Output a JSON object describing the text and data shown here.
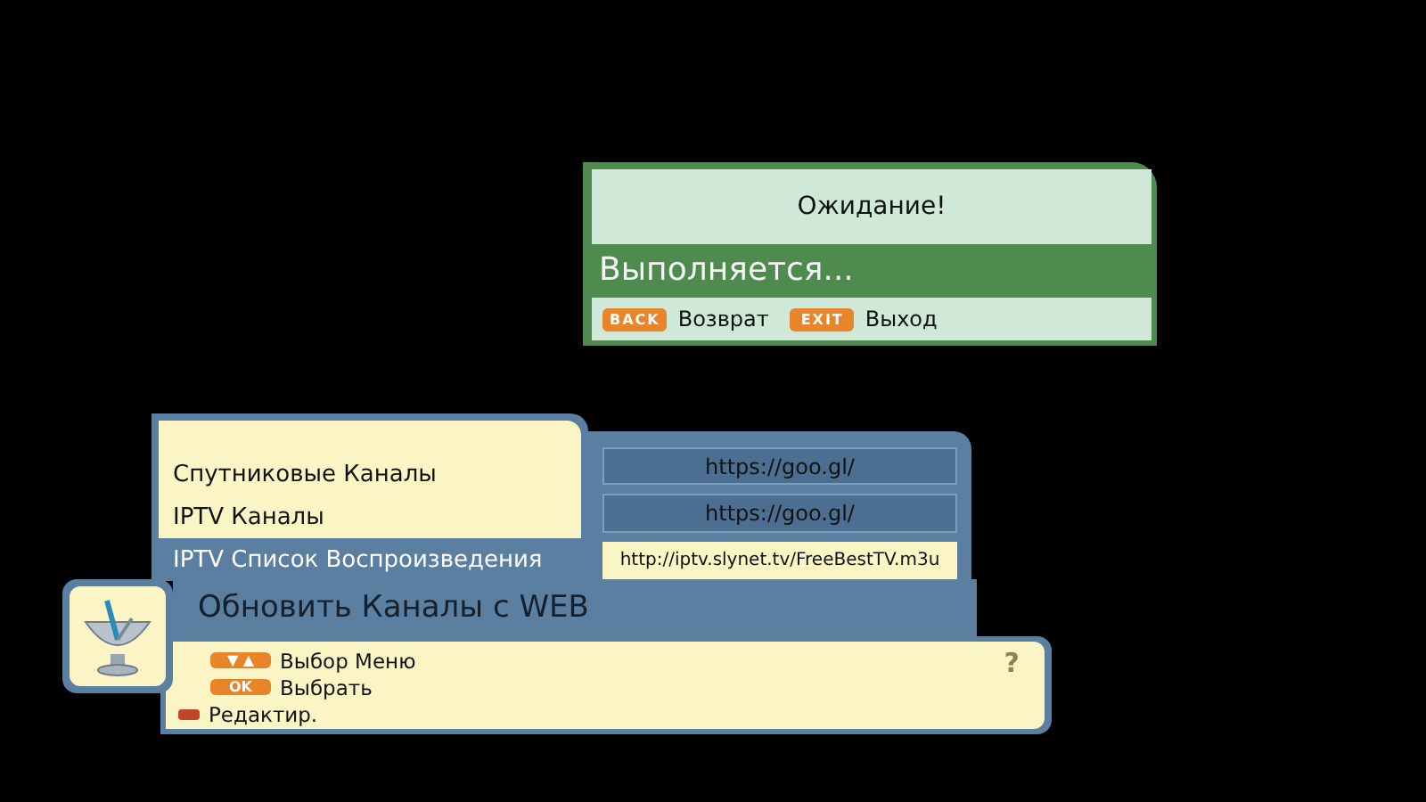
{
  "dialog": {
    "title": "Ожидание!",
    "status": "Выполняется...",
    "keys": [
      {
        "key": "BACK",
        "label": "Возврат"
      },
      {
        "key": "EXIT",
        "label": "Выход"
      }
    ]
  },
  "menu": {
    "items": [
      {
        "label": "Спутниковые Каналы",
        "url": "https://goo.gl/",
        "selected": false
      },
      {
        "label": "IPTV Каналы",
        "url": "https://goo.gl/",
        "selected": false
      },
      {
        "label": "IPTV Список Воспроизведения",
        "url": "http://iptv.slynet.tv/FreeBestTV.m3u",
        "selected": true
      }
    ],
    "title": "Обновить Каналы с WEB",
    "help": [
      {
        "kind": "key",
        "key": "▼ ▲",
        "label": "Выбор Меню"
      },
      {
        "kind": "key",
        "key": "OK",
        "label": "Выбрать"
      },
      {
        "kind": "color",
        "color": "#c0452a",
        "label": "Редактир."
      }
    ],
    "help_glyph": "?"
  }
}
